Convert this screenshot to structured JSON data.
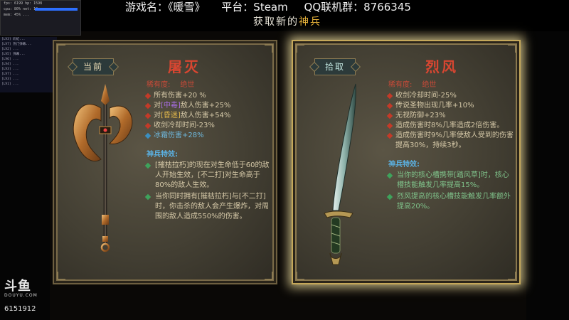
{
  "stream": {
    "title_game": "游戏名：《暖雪》",
    "title_platform": "平台：Steam",
    "title_qq": "QQ联机群：8766345",
    "banner_prefix": "获取新的",
    "banner_accent": "神兵"
  },
  "overlay": {
    "stats_rows": [
      "fps: 6199   hp: 1598",
      "cpu: 80%   net: 12",
      "mem: 45%   ..."
    ],
    "chat_lines": [
      "[LV3] 彩虹...",
      "[LV7] 热门弹幕...",
      "[LV2] ...",
      "[LV5] 弹幕...",
      "[LV6] ...",
      "[LV4] ...",
      "[LV3] ...",
      "[LV7] ...",
      "[LV3] ...",
      "[LV1] ..."
    ]
  },
  "cards": {
    "left": {
      "tag": "当前",
      "name": "屠灭",
      "rarity_label": "稀有度:",
      "rarity_value": "绝世",
      "stats": [
        {
          "pre": "所有伤害+20 %",
          "hl": "",
          "post": "",
          "hlclass": ""
        },
        {
          "pre": "对",
          "hl": "[中毒]",
          "post": "敌人伤害+25%",
          "hlclass": "hl-purple"
        },
        {
          "pre": "对",
          "hl": "[昏迷]",
          "post": "敌人伤害+54%",
          "hlclass": "hl-gold"
        },
        {
          "pre": "收剑冷却时间-23%",
          "hl": "",
          "post": "",
          "hlclass": ""
        },
        {
          "pre": "冰霜伤害+28%",
          "hl": "",
          "post": "",
          "hlclass": "",
          "blue": true
        }
      ],
      "special_title": "神兵特效:",
      "special": [
        "[摧枯拉朽]的现在对生命低于60的敌人开始生效，[不二打]对生命高于80%的敌人生效。",
        "当你同时拥有[摧枯拉朽]与[不二打]时，你击杀的敌人会产生爆炸，对周围的敌人造成550%的伤害。"
      ]
    },
    "right": {
      "tag": "拾取",
      "name": "烈风",
      "rarity_label": "稀有度:",
      "rarity_value": "绝世",
      "stats": [
        "收剑冷却时间-25%",
        "传说圣物出现几率+10%",
        "无视防御+23%",
        "造成伤害时8%几率造成2倍伤害。",
        "造成伤害时9%几率使敌人受到的伤害提高30%，持续3秒。"
      ],
      "special_title": "神兵特效:",
      "special": [
        "当你的核心槽携带[踏风草]时，核心槽技能触发几率提高15%。",
        "烈风提高的核心槽技能触发几率额外提高20%。"
      ]
    }
  },
  "douyu": {
    "logo": "斗鱼",
    "domain": "DOUYU.COM",
    "room": "6151912"
  }
}
